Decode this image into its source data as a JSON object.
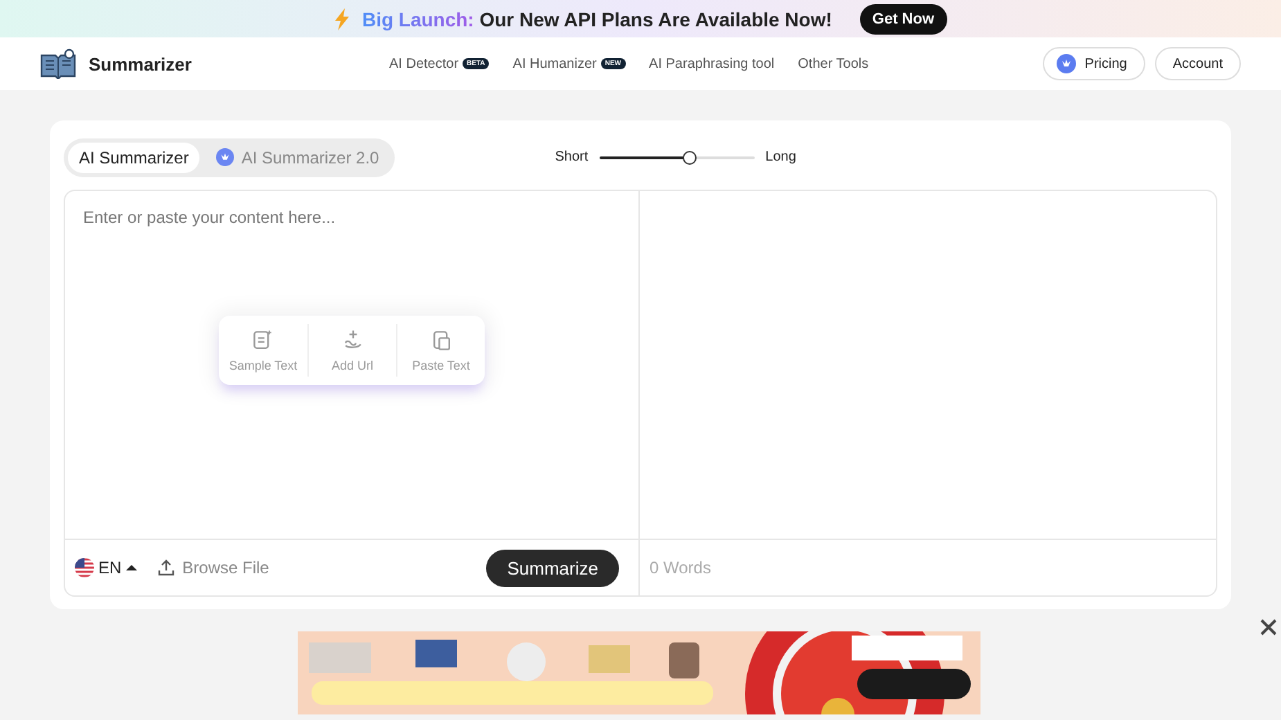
{
  "announcement": {
    "highlight": "Big Launch:",
    "text": "Our New API Plans Are Available Now!",
    "button": "Get Now"
  },
  "nav": {
    "brand": "Summarizer",
    "links": [
      {
        "label": "AI Detector",
        "badge": "BETA"
      },
      {
        "label": "AI Humanizer",
        "badge": "NEW"
      },
      {
        "label": "AI Paraphrasing tool"
      },
      {
        "label": "Other Tools"
      }
    ],
    "actions": [
      "Pricing",
      "Account"
    ]
  },
  "tabs": [
    {
      "label": "AI Summarizer",
      "selected": true
    },
    {
      "label": "AI Summarizer 2.0",
      "selected": false
    }
  ],
  "length": {
    "min_label": "Short",
    "max_label": "Long",
    "level": 0.59
  },
  "editor": {
    "placeholder": "Enter or paste your content here...",
    "quick_actions": [
      {
        "label": "Sample Text"
      },
      {
        "label": "Add Url"
      },
      {
        "label": "Paste Text"
      }
    ],
    "language": "EN",
    "browse": "Browse File",
    "submit": "Summarize",
    "word_count": "0 Words"
  }
}
